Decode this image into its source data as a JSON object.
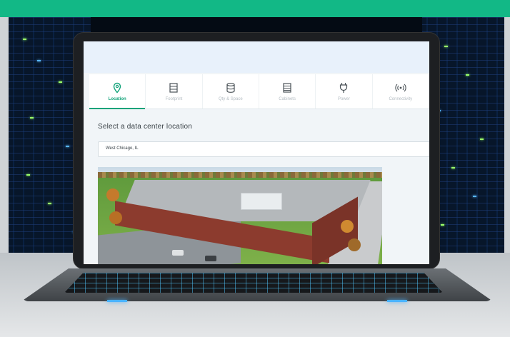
{
  "colors": {
    "brand": "#12b886",
    "active_tab": "#13a37a",
    "inactive_tab": "#b4bcc2"
  },
  "wizard": {
    "steps": [
      {
        "label": "Location",
        "icon": "location-pin-icon",
        "active": true
      },
      {
        "label": "Footprint",
        "icon": "server-stack-icon",
        "active": false
      },
      {
        "label": "Qty & Space",
        "icon": "database-icon",
        "active": false
      },
      {
        "label": "Cabinets",
        "icon": "cabinet-icon",
        "active": false
      },
      {
        "label": "Power",
        "icon": "power-plug-icon",
        "active": false
      },
      {
        "label": "Connectivity",
        "icon": "wireless-signal-icon",
        "active": false
      }
    ]
  },
  "main": {
    "section_title": "Select a data center location",
    "location_select": {
      "value": "West Chicago, IL"
    }
  }
}
